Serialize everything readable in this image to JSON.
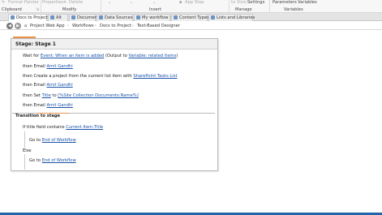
{
  "ribbon": {
    "format_painter": "Format Painter",
    "properties": "Properties",
    "delete": "Delete",
    "app_step": "App Step",
    "to_visio": "to Visio",
    "settings": "Settings",
    "parameters": "Parameters",
    "variables": "Variables",
    "groups": {
      "clipboard": "Clipboard",
      "modify": "Modify",
      "insert": "Insert",
      "manage": "Manage",
      "variables": "Variables"
    }
  },
  "tabs": [
    {
      "label": "Docs to Project"
    },
    {
      "label": "Alt"
    },
    {
      "label": "Document"
    },
    {
      "label": "Data Sources"
    },
    {
      "label": "My workflow"
    },
    {
      "label": "Content Types"
    },
    {
      "label": "Lists and Libraries"
    }
  ],
  "breadcrumb": [
    "Project Web App",
    "Workflows",
    "Docs to Project",
    "Text-Based Designer"
  ],
  "stage": {
    "title": "Stage: Stage 1",
    "actions": {
      "wait": {
        "prefix": "Wait for",
        "link1": "Event: When an item is added",
        "mid": "(Output to",
        "link2": "Variable: related items",
        "suffix": ")"
      },
      "email1": {
        "prefix": "then Email",
        "link": "Amit Gandhi"
      },
      "create": {
        "prefix": "then Create a project from the current list item with",
        "link": "SharePoint Tasks List"
      },
      "email2": {
        "prefix": "then Email",
        "link": "Amit Gandhi"
      },
      "set": {
        "prefix": "then Set",
        "link1": "Title",
        "mid": "to",
        "link2": "[%Site Collection Documents:Name%]"
      },
      "email3": {
        "prefix": "then Email",
        "link": "Amit Gandhi"
      }
    },
    "transition": {
      "label": "Transition to stage",
      "if": {
        "prefix": "If title field contains",
        "link": "Current Item:Title"
      },
      "goto1": {
        "prefix": "Go to",
        "link": "End of Workflow"
      },
      "else": "Else",
      "goto2": {
        "prefix": "Go to",
        "link": "End of Workflow"
      }
    }
  },
  "colors": {
    "accent": "#e8924a",
    "link": "#1a52a8",
    "status_bar": "#1f63a9"
  }
}
